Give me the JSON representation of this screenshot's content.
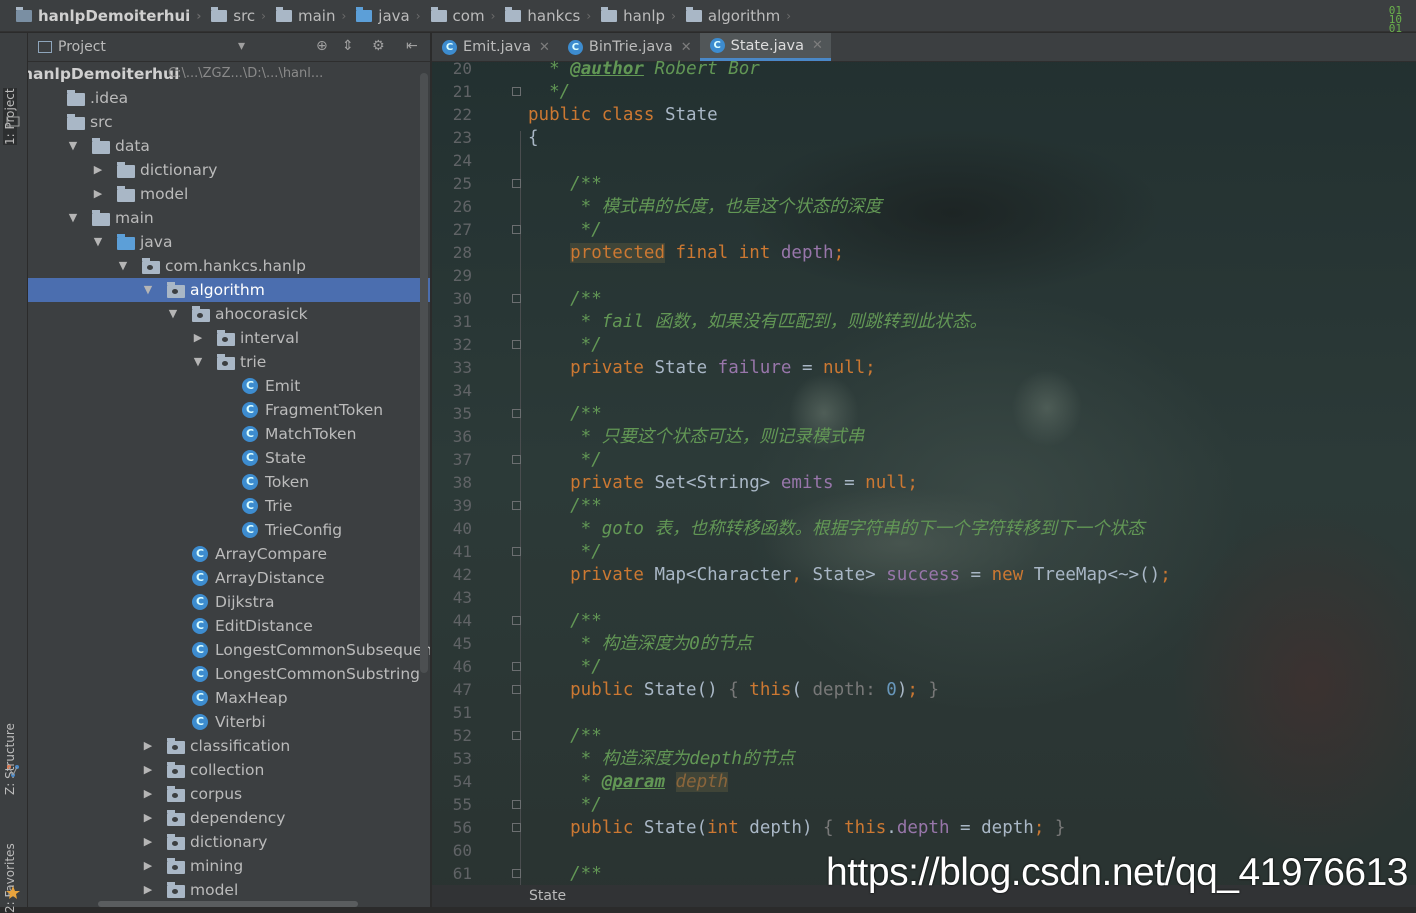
{
  "breadcrumb": {
    "items": [
      "hanlpDemoiterhui",
      "src",
      "main",
      "java",
      "com",
      "hankcs",
      "hanlp",
      "algorithm"
    ]
  },
  "tool_windows": {
    "project_tab": "1: Project",
    "structure_tab": "Z: Structure",
    "favorites_tab": "2: Favorites"
  },
  "project_panel": {
    "title": "Project",
    "root_label": "hanlpDemoiterhui",
    "root_path": "C:\\...\\ZGZ...\\D:\\...\\hanl...",
    "tree": [
      {
        "label": ".idea",
        "indent": 0,
        "icon": "folder"
      },
      {
        "label": "src",
        "indent": 0,
        "icon": "folder"
      },
      {
        "label": "data",
        "indent": 1,
        "icon": "folder",
        "arrow": "open"
      },
      {
        "label": "dictionary",
        "indent": 2,
        "icon": "folder",
        "arrow": "closed"
      },
      {
        "label": "model",
        "indent": 2,
        "icon": "folder",
        "arrow": "closed"
      },
      {
        "label": "main",
        "indent": 1,
        "icon": "folder",
        "arrow": "open"
      },
      {
        "label": "java",
        "indent": 2,
        "icon": "folder-blue",
        "arrow": "open"
      },
      {
        "label": "com.hankcs.hanlp",
        "indent": 3,
        "icon": "package",
        "arrow": "open"
      },
      {
        "label": "algorithm",
        "indent": 4,
        "icon": "package",
        "arrow": "open",
        "selected": true
      },
      {
        "label": "ahocorasick",
        "indent": 5,
        "icon": "package",
        "arrow": "open"
      },
      {
        "label": "interval",
        "indent": 6,
        "icon": "package",
        "arrow": "closed"
      },
      {
        "label": "trie",
        "indent": 6,
        "icon": "package",
        "arrow": "open"
      },
      {
        "label": "Emit",
        "indent": 7,
        "icon": "class"
      },
      {
        "label": "FragmentToken",
        "indent": 7,
        "icon": "class"
      },
      {
        "label": "MatchToken",
        "indent": 7,
        "icon": "class"
      },
      {
        "label": "State",
        "indent": 7,
        "icon": "class"
      },
      {
        "label": "Token",
        "indent": 7,
        "icon": "class"
      },
      {
        "label": "Trie",
        "indent": 7,
        "icon": "class"
      },
      {
        "label": "TrieConfig",
        "indent": 7,
        "icon": "class"
      },
      {
        "label": "ArrayCompare",
        "indent": 5,
        "icon": "class"
      },
      {
        "label": "ArrayDistance",
        "indent": 5,
        "icon": "class"
      },
      {
        "label": "Dijkstra",
        "indent": 5,
        "icon": "class"
      },
      {
        "label": "EditDistance",
        "indent": 5,
        "icon": "class"
      },
      {
        "label": "LongestCommonSubsequence",
        "indent": 5,
        "icon": "class"
      },
      {
        "label": "LongestCommonSubstring",
        "indent": 5,
        "icon": "class"
      },
      {
        "label": "MaxHeap",
        "indent": 5,
        "icon": "class"
      },
      {
        "label": "Viterbi",
        "indent": 5,
        "icon": "class"
      },
      {
        "label": "classification",
        "indent": 4,
        "icon": "package",
        "arrow": "closed"
      },
      {
        "label": "collection",
        "indent": 4,
        "icon": "package",
        "arrow": "closed"
      },
      {
        "label": "corpus",
        "indent": 4,
        "icon": "package",
        "arrow": "closed"
      },
      {
        "label": "dependency",
        "indent": 4,
        "icon": "package",
        "arrow": "closed"
      },
      {
        "label": "dictionary",
        "indent": 4,
        "icon": "package",
        "arrow": "closed"
      },
      {
        "label": "mining",
        "indent": 4,
        "icon": "package",
        "arrow": "closed"
      },
      {
        "label": "model",
        "indent": 4,
        "icon": "package",
        "arrow": "closed"
      }
    ]
  },
  "editor": {
    "tabs": [
      {
        "label": "Emit.java",
        "active": false
      },
      {
        "label": "BinTrie.java",
        "active": false
      },
      {
        "label": "State.java",
        "active": true
      }
    ],
    "line_numbers": [
      "20",
      "21",
      "22",
      "23",
      "24",
      "25",
      "26",
      "27",
      "28",
      "29",
      "30",
      "31",
      "32",
      "33",
      "34",
      "35",
      "36",
      "37",
      "38",
      "39",
      "40",
      "41",
      "42",
      "43",
      "44",
      "45",
      "46",
      "47",
      "51",
      "52",
      "53",
      "54",
      "55",
      "56",
      "60",
      "61"
    ],
    "fold_lines": [
      "21",
      "25",
      "27",
      "30",
      "32",
      "35",
      "37",
      "39",
      "41",
      "44",
      "46",
      "47",
      "52",
      "55",
      "56",
      "61"
    ],
    "footer_breadcrumb": "State",
    "watermark": "https://blog.csdn.net/qq_41976613",
    "code": {
      "l20_author": "@author",
      "l20_name": "Robert Bor",
      "c26": "模式串的长度，也是这个状态的深度",
      "c31": "fail 函数，如果没有匹配到，则跳转到此状态。",
      "c36": "只要这个状态可达，则记录模式串",
      "c40": "goto 表，也称转移函数。根据字符串的下一个字符转移到下一个状态",
      "c45": "构造深度为0的节点",
      "c53": "构造深度为depth的节点",
      "c54_tag": "@param",
      "c54_param": "depth"
    }
  }
}
